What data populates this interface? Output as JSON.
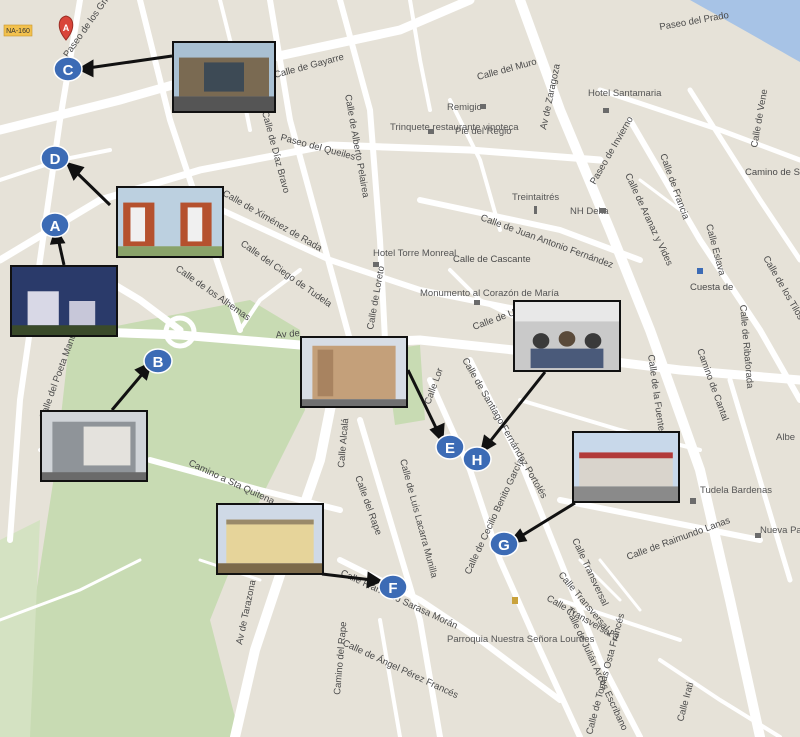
{
  "map": {
    "colors": {
      "land": "#e6e2d8",
      "road": "#ffffff",
      "park": "#c8dbb3",
      "river": "#a7c3e6",
      "marker": "#3c6bb5",
      "pin": "#d9453a"
    },
    "road_badge": "NA-160",
    "streets": [
      "Paseo de los Grillos",
      "Calle de Gayarre",
      "Calle del Muro",
      "Paseo del Prado",
      "Av de Zaragoza",
      "Paseo de Invierno",
      "Calle de Francia",
      "Calle de Aranaz y Vides",
      "Calle de Díaz Bravo",
      "Calle de Alberto Pelairea",
      "Calle de Ximénez de Rada",
      "Calle del Ciego de Tudela",
      "Calle de los Alhemas",
      "Paseo del Queiles",
      "Calle de Juan Antonio Fernández",
      "Calle de Cascante",
      "Calle de Loreto",
      "Calle Lor",
      "Calle de Santiago Fernández Portolés",
      "Calle de Cecilio Benito García",
      "Calle de Raimundo Lanas",
      "Calle de Julián Arcos Escribano",
      "Calle de Tomás Osta Francés",
      "Calle Irati",
      "Calle Transversal",
      "Calle Transversal 2",
      "Calle Transversal 3",
      "Av de Tarazona",
      "Calle Alcalá",
      "Calle del Rape",
      "Camino del Rape",
      "Calle Francisco Sarasa Morán",
      "Calle de Ángel Pérez Francés",
      "Calle de Luis Lacarra Munilla",
      "Camino a Sta Quitena",
      "Calle del Poeta Manuel Alfonso",
      "Calle de Ribaforada",
      "Camino de Cantal",
      "Calle de la Fuente",
      "Calle de Urz",
      "Camino de San",
      "Calle de Vene",
      "Calle de los Tilos",
      "Calle Eslava",
      "Cuesta de",
      "Av de"
    ],
    "pois": [
      "Hotel Santamaria",
      "Remigio",
      "Trinquete restaurante vinoteca",
      "Pie del Regio",
      "Treintaitrés",
      "NH Delta",
      "Hotel Torre Monreal",
      "Monumento al Corazón de María",
      "Parroquia Nuestra Señora Lourdes",
      "Tudela Bardenas",
      "Nueva Parrilla",
      "Albe"
    ],
    "markers": [
      "A",
      "A",
      "B",
      "C",
      "D",
      "E",
      "F",
      "G",
      "H"
    ],
    "pin_label": "A",
    "photos": [
      {
        "name": "photo-c",
        "target": "C",
        "subject": "modern glass building"
      },
      {
        "name": "photo-d",
        "target": "D",
        "subject": "red and white apartment blocks"
      },
      {
        "name": "photo-a",
        "target": "A",
        "subject": "apartments at dusk"
      },
      {
        "name": "photo-b",
        "target": "B",
        "subject": "grey apartment block"
      },
      {
        "name": "photo-e",
        "target": "E",
        "subject": "beige apartment building"
      },
      {
        "name": "photo-h",
        "target": "H",
        "subject": "people in a meeting room"
      },
      {
        "name": "photo-g",
        "target": "G",
        "subject": "industrial warehouse"
      },
      {
        "name": "photo-f",
        "target": "F",
        "subject": "yellow apartment block"
      }
    ]
  }
}
